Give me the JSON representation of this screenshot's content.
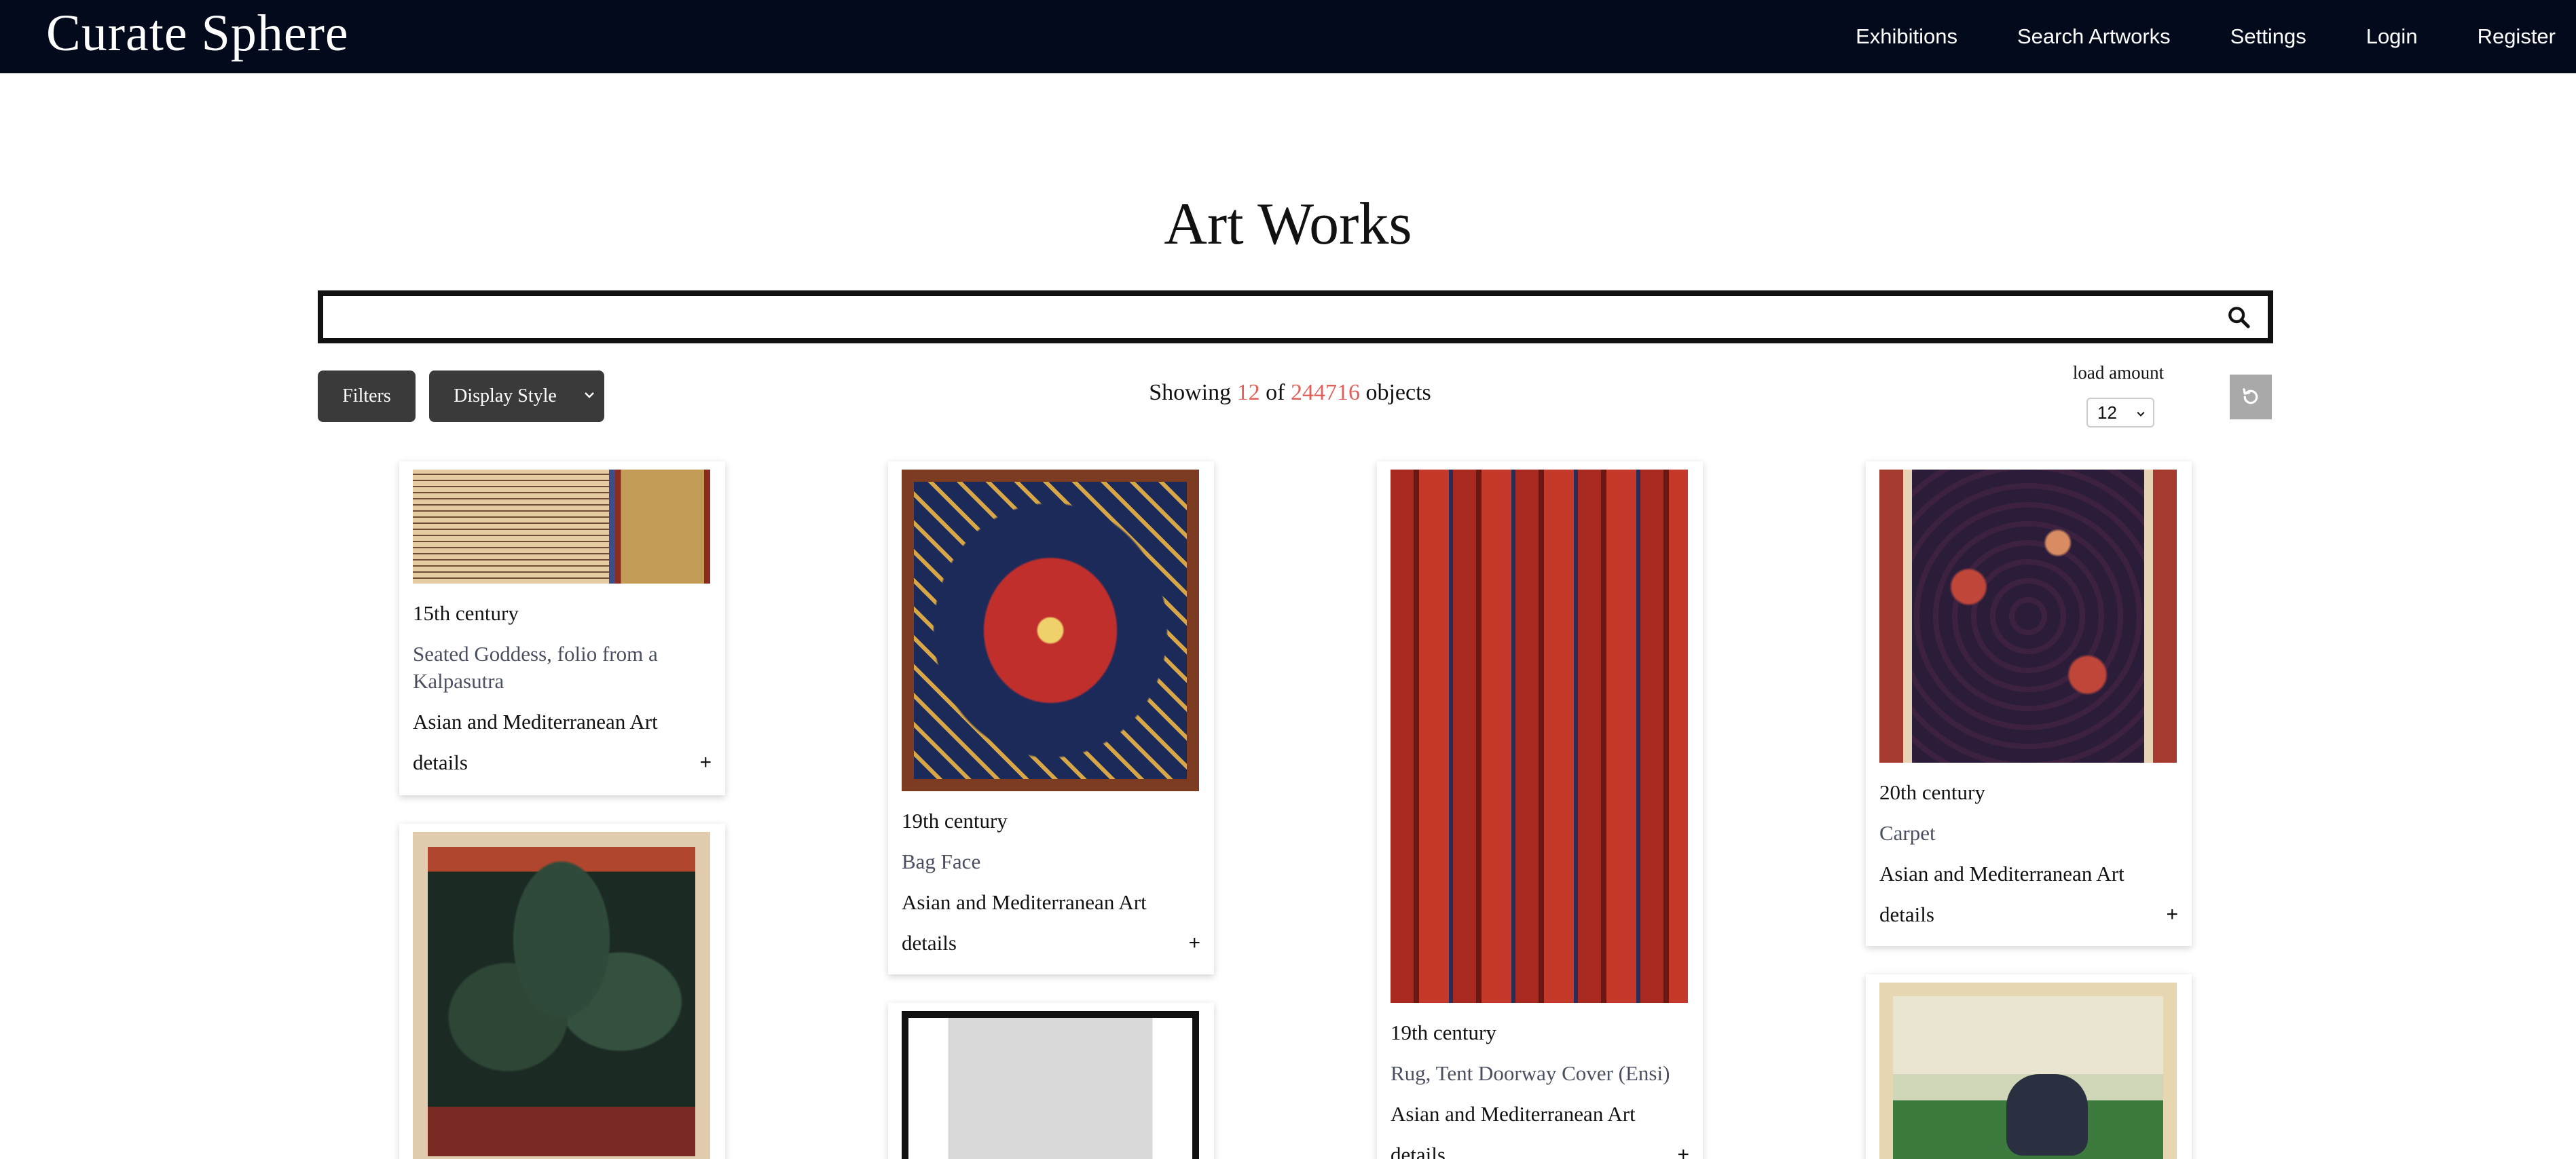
{
  "app": {
    "brand": "Curate Sphere"
  },
  "nav": {
    "items": [
      "Exhibitions",
      "Search Artworks",
      "Settings",
      "Login",
      "Register"
    ]
  },
  "page": {
    "title": "Art Works"
  },
  "search": {
    "value": "",
    "placeholder": ""
  },
  "controls": {
    "filters_label": "Filters",
    "display_style_label": "Display Style",
    "showing_prefix": "Showing",
    "showing_count": "12",
    "showing_of": "of",
    "showing_total": "244716",
    "showing_suffix": "objects",
    "load_amount_label": "load amount",
    "load_amount_value": "12"
  },
  "colors": {
    "nav_bg": "#030a1c",
    "accent_count": "#e0605a",
    "button_dark": "#3a3a3a",
    "reset_bg": "#a9a9a9"
  },
  "artworks": [
    {
      "century": "15th century",
      "title": "Seated Goddess, folio from a Kalpasutra",
      "department": "Asian and Mediterranean Art",
      "details_label": "details",
      "expand": "+"
    },
    {
      "century": "19th century",
      "title": "Bag Face",
      "department": "Asian and Mediterranean Art",
      "details_label": "details",
      "expand": "+"
    },
    {
      "century": "19th century",
      "title": "Rug, Tent Doorway Cover (Ensi)",
      "department": "Asian and Mediterranean Art",
      "details_label": "details",
      "expand": "+"
    },
    {
      "century": "20th century",
      "title": "Carpet",
      "department": "Asian and Mediterranean Art",
      "details_label": "details",
      "expand": "+"
    }
  ]
}
